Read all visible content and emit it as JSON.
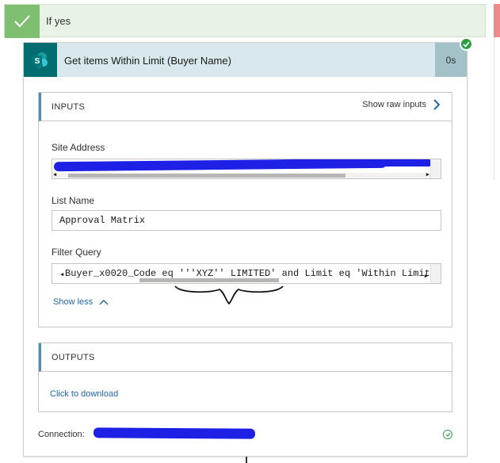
{
  "branch": {
    "title": "If yes"
  },
  "action": {
    "title": "Get items Within Limit (Buyer Name)",
    "duration": "0s",
    "icon": "sharepoint-icon",
    "status_icon": "check-circle-icon"
  },
  "inputs": {
    "header": "INPUTS",
    "show_raw_label": "Show raw inputs",
    "site_address": {
      "label": "Site Address",
      "value": ""
    },
    "list_name": {
      "label": "List Name",
      "value": "Approval Matrix"
    },
    "filter_query": {
      "label": "Filter Query",
      "value": "Buyer_x0020_Code eq '''XYZ'' LIMITED' and Limit eq 'Within Limit"
    },
    "show_less_label": "Show less"
  },
  "outputs": {
    "header": "OUTPUTS",
    "download_label": "Click to download"
  },
  "connection": {
    "label": "Connection:",
    "value": ""
  },
  "colors": {
    "success": "#7fbf71",
    "sharepoint": "#036c70",
    "header_bg": "#d9e8ec",
    "link": "#2266aa",
    "redaction": "#1f20e6"
  }
}
